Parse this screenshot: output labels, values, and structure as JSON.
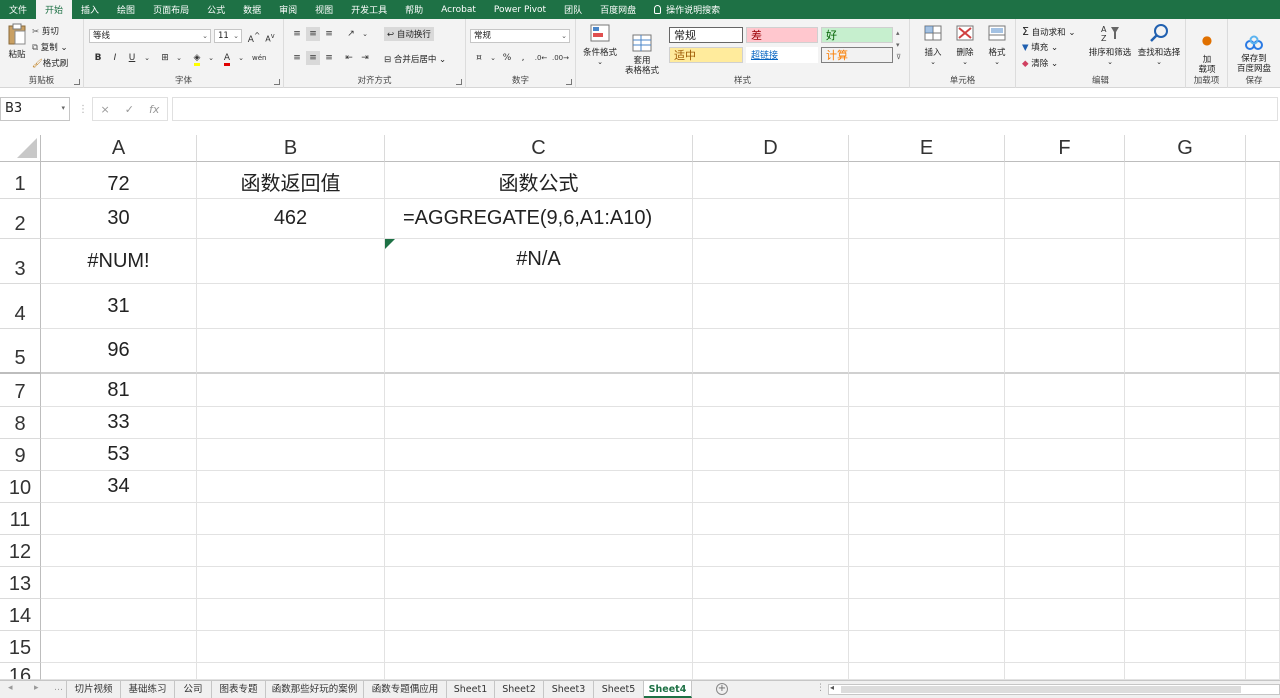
{
  "ribbon": {
    "tabs": [
      "文件",
      "开始",
      "插入",
      "绘图",
      "页面布局",
      "公式",
      "数据",
      "审阅",
      "视图",
      "开发工具",
      "帮助",
      "Acrobat",
      "Power Pivot",
      "团队",
      "百度网盘",
      "操作说明搜索"
    ],
    "active_tab": "开始",
    "clipboard": {
      "paste": "粘贴",
      "cut": "剪切",
      "copy": "复制",
      "format_painter": "格式刷",
      "label": "剪贴板"
    },
    "font": {
      "name": "等线",
      "size": "11",
      "bold": "B",
      "italic": "I",
      "underline": "U",
      "grow": "A",
      "shrink": "A",
      "color_a": "A",
      "wen": "wén",
      "label": "字体"
    },
    "alignment": {
      "wrap": "自动换行",
      "merge": "合并后居中",
      "label": "对齐方式"
    },
    "number": {
      "format": "常规",
      "percent": "%",
      "comma": ",",
      "label": "数字"
    },
    "styles": {
      "conditional": "条件格式",
      "table_format": "套用\n表格格式",
      "normal": "常规",
      "bad": "差",
      "good": "好",
      "neutral": "适中",
      "hyperlink": "超链接",
      "calc": "计算",
      "label": "样式"
    },
    "cells": {
      "insert": "插入",
      "delete": "删除",
      "format": "格式",
      "label": "单元格"
    },
    "editing": {
      "autosum": "自动求和",
      "fill": "填充",
      "clear": "清除",
      "sort": "排序和筛选",
      "find": "查找和选择",
      "label": "编辑"
    },
    "addins": {
      "load": "加\n载项",
      "label": "加载项"
    },
    "save": {
      "save_to": "保存到\n百度网盘",
      "label": "保存"
    }
  },
  "formula_bar": {
    "name_box": "B3",
    "cancel": "×",
    "enter": "✓",
    "fx": "fx",
    "formula": ""
  },
  "grid": {
    "columns": [
      "A",
      "B",
      "C",
      "D",
      "E",
      "F",
      "G"
    ],
    "rows": [
      "1",
      "2",
      "3",
      "4",
      "5",
      "7",
      "8",
      "9",
      "10",
      "11",
      "12",
      "13",
      "14",
      "15",
      "16"
    ],
    "cells": {
      "A1": "72",
      "B1": "函数返回值",
      "C1": "函数公式",
      "A2": "30",
      "B2": "462",
      "C2": "=AGGREGATE(9,6,A1:A10)",
      "A3": "#NUM!",
      "C3": "#N/A",
      "A4": "31",
      "A5": "96",
      "A7": "81",
      "A8": "33",
      "A9": "53",
      "A10": "34"
    }
  },
  "sheet_tabs": [
    "切片视频",
    "基础练习",
    "公司",
    "图表专题",
    "函数那些好玩的案例",
    "函数专题偶应用",
    "Sheet1",
    "Sheet2",
    "Sheet3",
    "Sheet5",
    "Sheet4"
  ],
  "active_sheet": "Sheet4",
  "colors": {
    "accent": "#1e7145",
    "bad_bg": "#ffc7ce",
    "good_bg": "#c6efce",
    "neutral_bg": "#ffeb9c"
  }
}
